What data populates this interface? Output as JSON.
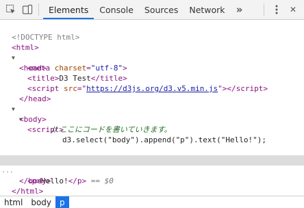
{
  "toolbar": {
    "inspect_icon": "inspect-element-icon",
    "device_icon": "device-toggle-icon",
    "tabs": [
      "Elements",
      "Console",
      "Sources",
      "Network"
    ],
    "more_label": "»",
    "menu_icon": "kebab-menu-icon",
    "close_label": "✕"
  },
  "dom": {
    "doctype": "<!DOCTYPE html>",
    "html_open": "html",
    "head_open": "head",
    "meta_tag": "meta",
    "meta_attr": "charset",
    "meta_val": "\"utf-8\"",
    "title_tag": "title",
    "title_text": "D3 Test",
    "script_tag": "script",
    "script_attr": "src",
    "script_src": "https://d3js.org/d3.v5.min.js",
    "head_close": "head",
    "body_open": "body",
    "inline_comment": "// ここにコードを書いていきます。",
    "inline_code": "d3.select(\"body\").append(\"p\").text(\"Hello!\");",
    "p_tag": "p",
    "p_text": "Hello!",
    "selected_marker": "== $0",
    "body_close": "body",
    "html_close": "html",
    "dots": "..."
  },
  "breadcrumbs": [
    "html",
    "body",
    "p"
  ]
}
